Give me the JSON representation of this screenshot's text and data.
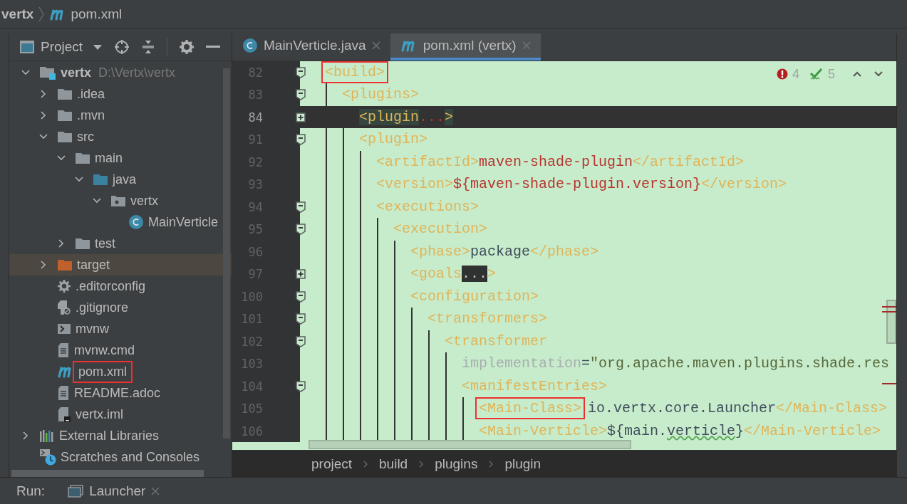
{
  "nav_bar": {
    "project": "vertx",
    "file": "pom.xml"
  },
  "project_panel": {
    "title": "Project",
    "tree": [
      {
        "label": "vertx",
        "path": "D:\\Vertx\\vertx",
        "kind": "module",
        "expanded": true,
        "selected": false,
        "children": [
          {
            "label": ".idea",
            "kind": "folder",
            "expanded": false,
            "selected": false
          },
          {
            "label": ".mvn",
            "kind": "folder",
            "expanded": false,
            "selected": false
          },
          {
            "label": "src",
            "kind": "folder",
            "expanded": true,
            "selected": false,
            "children": [
              {
                "label": "main",
                "kind": "folder",
                "expanded": true,
                "selected": false,
                "children": [
                  {
                    "label": "java",
                    "kind": "source-folder",
                    "expanded": true,
                    "selected": false,
                    "children": [
                      {
                        "label": "vertx",
                        "kind": "package",
                        "expanded": true,
                        "selected": false,
                        "children": [
                          {
                            "label": "MainVerticle",
                            "kind": "class",
                            "selected": false
                          }
                        ]
                      }
                    ]
                  }
                ]
              },
              {
                "label": "test",
                "kind": "folder",
                "expanded": false,
                "selected": false
              }
            ]
          },
          {
            "label": "target",
            "kind": "target-folder",
            "expanded": false,
            "selected": true
          },
          {
            "label": ".editorconfig",
            "kind": "settings",
            "selected": false
          },
          {
            "label": ".gitignore",
            "kind": "ignore",
            "selected": false
          },
          {
            "label": "mvnw",
            "kind": "script",
            "selected": false
          },
          {
            "label": "mvnw.cmd",
            "kind": "text",
            "selected": false
          },
          {
            "label": "pom.xml",
            "kind": "maven",
            "selected": false,
            "annotated": true
          },
          {
            "label": "README.adoc",
            "kind": "text",
            "selected": false
          },
          {
            "label": "vertx.iml",
            "kind": "iml",
            "selected": false
          }
        ]
      },
      {
        "label": "External Libraries",
        "kind": "libraries",
        "expanded": false,
        "selected": false
      },
      {
        "label": "Scratches and Consoles",
        "kind": "scratches",
        "selected": false
      }
    ]
  },
  "editor": {
    "tabs": [
      {
        "label": "MainVerticle.java",
        "kind": "class",
        "selected": false
      },
      {
        "label": "pom.xml (vertx)",
        "kind": "maven",
        "selected": true
      }
    ],
    "inspections": {
      "errors": "4",
      "warnings": "5"
    },
    "lines": [
      {
        "number": "82",
        "folded": false,
        "tokens": [
          {
            "kind": "tag",
            "text": "<build>",
            "annotated": true
          }
        ],
        "children": [
          {
            "number": "83",
            "folded": false,
            "tokens": [
              {
                "kind": "tag",
                "text": "<plugins>"
              }
            ],
            "children": [
              {
                "number": "84",
                "folded": true,
                "current": true,
                "tokens": [
                  {
                    "kind": "tag",
                    "text": "<plugin"
                  },
                  {
                    "kind": "ellipsis",
                    "text": "..."
                  },
                  {
                    "kind": "tag",
                    "text": ">"
                  }
                ]
              },
              {
                "number": "91",
                "folded": false,
                "tokens": [
                  {
                    "kind": "tag",
                    "text": "<plugin>"
                  }
                ],
                "children": [
                  {
                    "number": "92",
                    "tokens": [
                      {
                        "kind": "tag",
                        "text": "<artifactId>"
                      },
                      {
                        "kind": "value",
                        "text": "maven-shade-plugin"
                      },
                      {
                        "kind": "tag",
                        "text": "</artifactId>"
                      }
                    ]
                  },
                  {
                    "number": "93",
                    "tokens": [
                      {
                        "kind": "tag",
                        "text": "<version>"
                      },
                      {
                        "kind": "value",
                        "text": "${maven-shade-plugin.version}"
                      },
                      {
                        "kind": "tag",
                        "text": "</version>"
                      }
                    ]
                  },
                  {
                    "number": "94",
                    "folded": false,
                    "tokens": [
                      {
                        "kind": "tag",
                        "text": "<executions>"
                      }
                    ],
                    "children": [
                      {
                        "number": "95",
                        "folded": false,
                        "tokens": [
                          {
                            "kind": "tag",
                            "text": "<execution>"
                          }
                        ],
                        "children": [
                          {
                            "number": "96",
                            "tokens": [
                              {
                                "kind": "tag",
                                "text": "<phase>"
                              },
                              {
                                "kind": "text",
                                "text": "package"
                              },
                              {
                                "kind": "tag",
                                "text": "</phase>"
                              }
                            ]
                          },
                          {
                            "number": "97",
                            "folded": true,
                            "tokens": [
                              {
                                "kind": "tag",
                                "text": "<goals"
                              },
                              {
                                "kind": "ellipsis",
                                "text": "..."
                              },
                              {
                                "kind": "tag",
                                "text": ">"
                              }
                            ]
                          },
                          {
                            "number": "100",
                            "folded": false,
                            "tokens": [
                              {
                                "kind": "tag",
                                "text": "<configuration>"
                              }
                            ],
                            "children": [
                              {
                                "number": "101",
                                "folded": false,
                                "tokens": [
                                  {
                                    "kind": "tag",
                                    "text": "<transformers>"
                                  }
                                ],
                                "children": [
                                  {
                                    "number": "102",
                                    "folded": false,
                                    "tokens": [
                                      {
                                        "kind": "tag",
                                        "text": "<transformer"
                                      }
                                    ],
                                    "children": [
                                      {
                                        "number": "103",
                                        "tokens": [
                                          {
                                            "kind": "attr",
                                            "text": "implementation"
                                          },
                                          {
                                            "kind": "text",
                                            "text": "="
                                          },
                                          {
                                            "kind": "string",
                                            "text": "\"org.apache.maven.plugins.shade.res"
                                          }
                                        ]
                                      },
                                      {
                                        "number": "104",
                                        "folded": false,
                                        "tokens": [
                                          {
                                            "kind": "tag",
                                            "text": "<manifestEntries>"
                                          }
                                        ],
                                        "children": [
                                          {
                                            "number": "105",
                                            "tokens": [
                                              {
                                                "kind": "tag",
                                                "text": "<Main-Class>",
                                                "annotated": true
                                              },
                                              {
                                                "kind": "text",
                                                "text": "io.vertx.core.Launcher"
                                              },
                                              {
                                                "kind": "tag",
                                                "text": "</Main-Class>"
                                              }
                                            ]
                                          },
                                          {
                                            "number": "106",
                                            "tokens": [
                                              {
                                                "kind": "tag",
                                                "text": "<Main-Verticle>"
                                              },
                                              {
                                                "kind": "text",
                                                "text": "${main."
                                              },
                                              {
                                                "kind": "typo",
                                                "text": "verticle"
                                              },
                                              {
                                                "kind": "text",
                                                "text": "}"
                                              },
                                              {
                                                "kind": "tag",
                                                "text": "</Main-Verticle>"
                                              }
                                            ]
                                          }
                                        ]
                                      }
                                    ]
                                  }
                                ]
                              }
                            ]
                          }
                        ]
                      }
                    ]
                  }
                ]
              }
            ]
          }
        ]
      }
    ],
    "path": [
      "project",
      "build",
      "plugins",
      "plugin"
    ]
  },
  "run_bar": {
    "label": "Run:",
    "tabs": [
      {
        "label": "Launcher"
      }
    ]
  }
}
